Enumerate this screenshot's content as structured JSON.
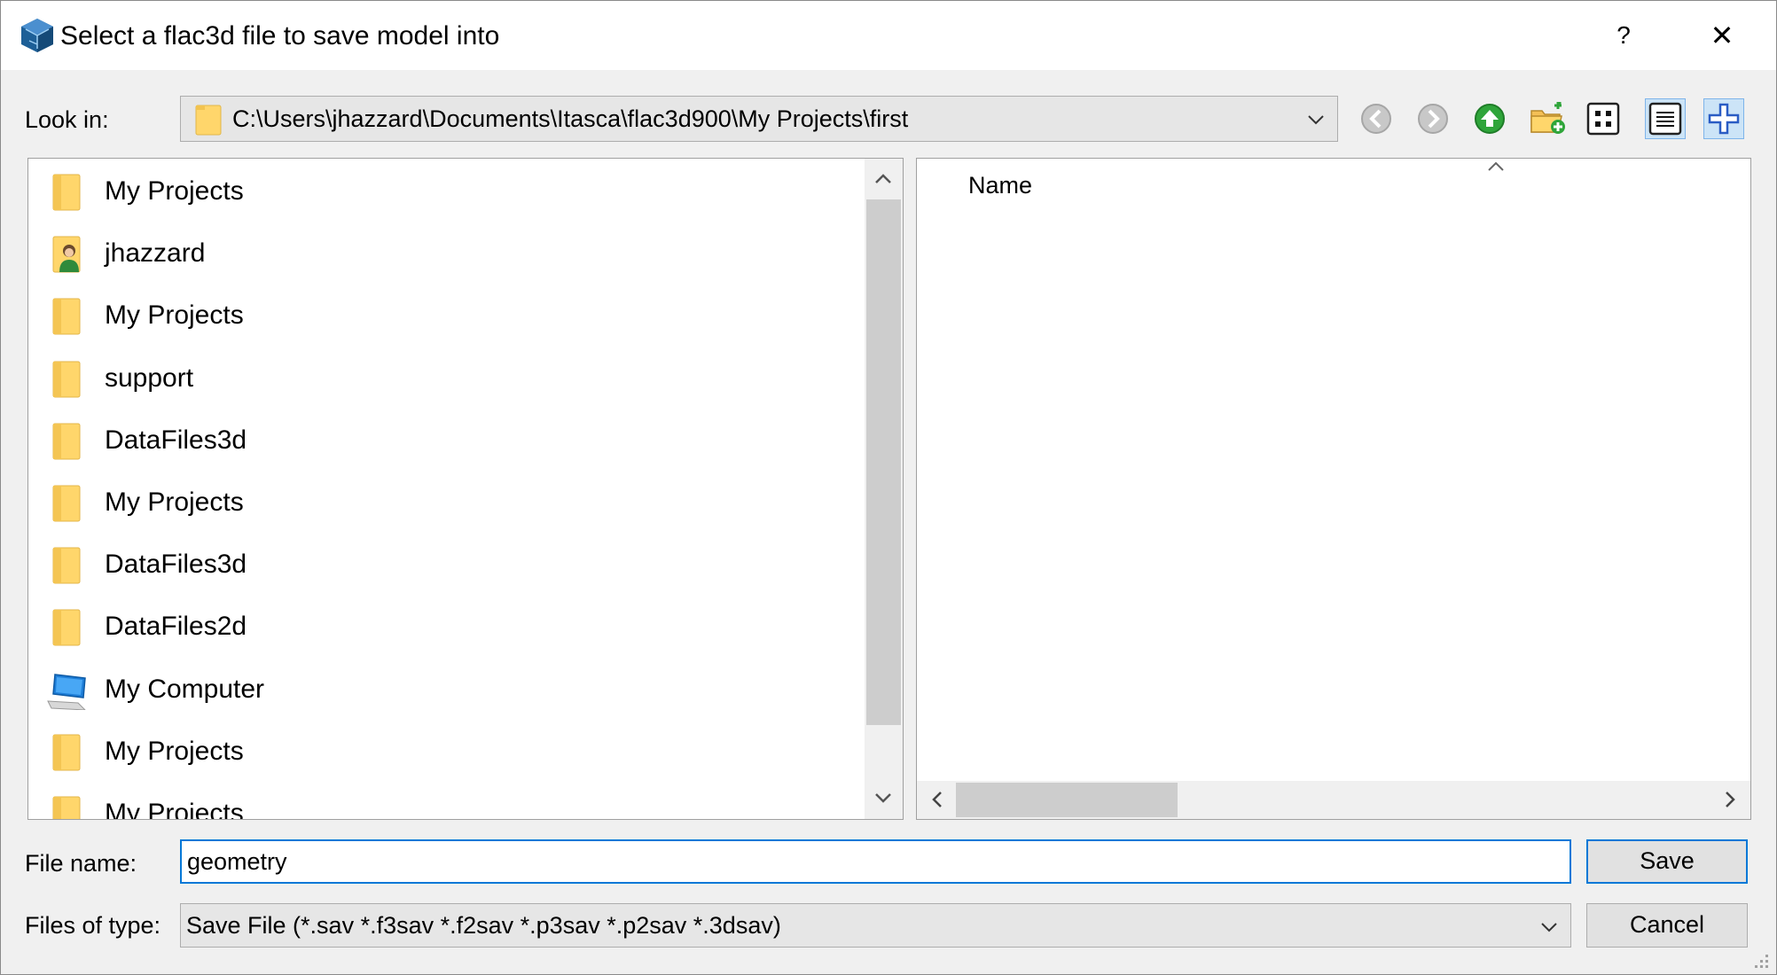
{
  "window": {
    "title": "Select a flac3d file to save model into",
    "help": "?",
    "close": "✕"
  },
  "lookin": {
    "label": "Look in:",
    "path": "C:\\Users\\jhazzard\\Documents\\Itasca\\flac3d900\\My Projects\\first"
  },
  "toolbar": {
    "buttons": [
      "back",
      "forward",
      "up-folder",
      "new-folder",
      "list-view",
      "detail-view",
      "new-item"
    ]
  },
  "sidebar": {
    "items": [
      {
        "label": "My Projects",
        "icon": "folder-icon"
      },
      {
        "label": "jhazzard",
        "icon": "user-folder-icon"
      },
      {
        "label": "My Projects",
        "icon": "folder-icon"
      },
      {
        "label": "support",
        "icon": "folder-icon"
      },
      {
        "label": "DataFiles3d",
        "icon": "folder-icon"
      },
      {
        "label": "My Projects",
        "icon": "folder-icon"
      },
      {
        "label": "DataFiles3d",
        "icon": "folder-icon"
      },
      {
        "label": "DataFiles2d",
        "icon": "folder-icon"
      },
      {
        "label": "My Computer",
        "icon": "computer-icon"
      },
      {
        "label": "My Projects",
        "icon": "folder-icon"
      },
      {
        "label": "My Projects",
        "icon": "folder-icon"
      }
    ]
  },
  "filelist": {
    "column_name": "Name"
  },
  "form": {
    "filename_label": "File name:",
    "filename_value": "geometry",
    "filetype_label": "Files of type:",
    "filetype_value": "Save File (*.sav *.f3sav *.f2sav *.p3sav *.p2sav *.3dsav)",
    "save_label": "Save",
    "cancel_label": "Cancel"
  },
  "colors": {
    "accent": "#0078d7",
    "folder": "#ffd66b",
    "dialog_bg": "#f0f0f0"
  }
}
